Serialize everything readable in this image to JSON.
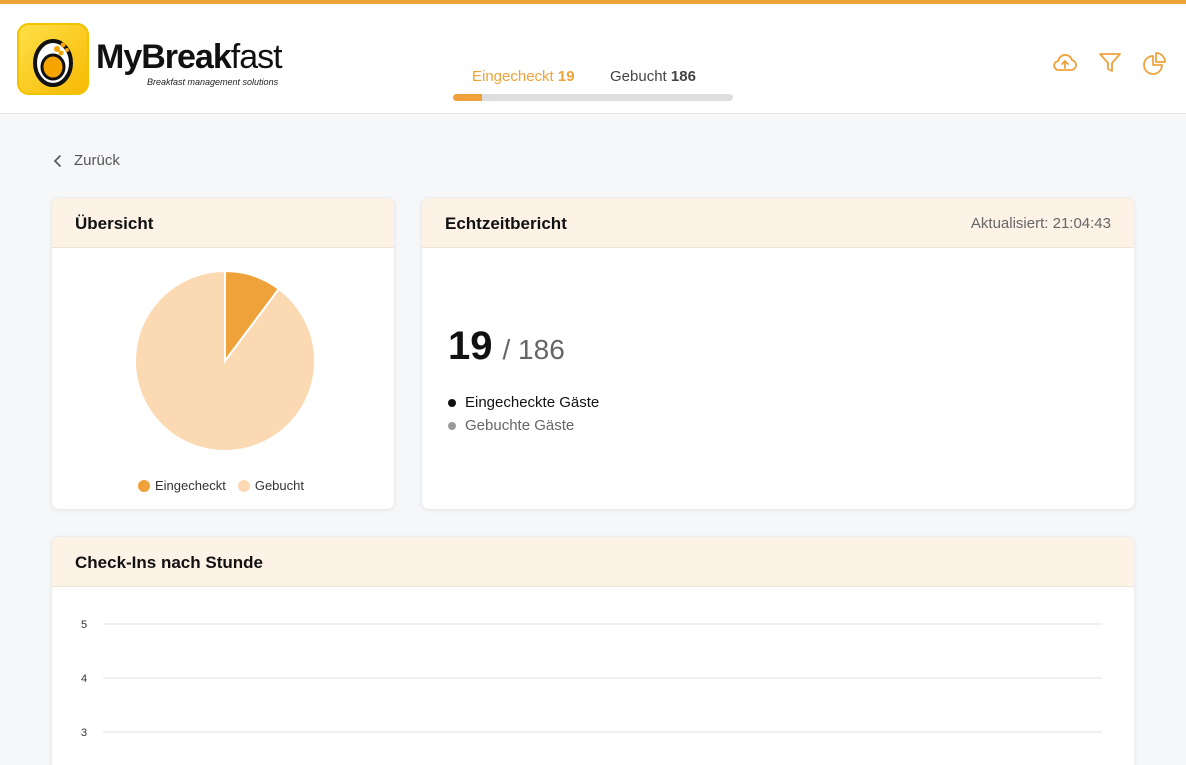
{
  "header": {
    "brand_bold": "MyBreak",
    "brand_rest": "fast",
    "brand_tagline": "Breakfast management solutions",
    "tabs": [
      {
        "label": "Eingecheckt",
        "count": "19"
      },
      {
        "label": "Gebucht",
        "count": "186"
      }
    ],
    "progress_fraction": 0.102,
    "icons": [
      "cloud-upload-icon",
      "filter-icon",
      "pie-chart-icon"
    ],
    "accent": "#f0a23a"
  },
  "nav": {
    "back_label": "Zurück"
  },
  "overview": {
    "title": "Übersicht",
    "legend": [
      {
        "label": "Eingecheckt",
        "color": "#f0a23a"
      },
      {
        "label": "Gebucht",
        "color": "#fbd9b3"
      }
    ]
  },
  "realtime": {
    "title": "Echtzeitbericht",
    "updated": "Aktualisiert: 21:04:43",
    "checked_in": "19",
    "booked": "/ 186",
    "legend": [
      {
        "label": "Eingecheckte Gäste",
        "color": "#111111"
      },
      {
        "label": "Gebuchte Gäste",
        "color": "#9a9a9a"
      }
    ]
  },
  "hourly": {
    "title": "Check-Ins nach Stunde"
  },
  "chart_data": [
    {
      "type": "pie",
      "labels": [
        "Eingecheckt",
        "Gebucht"
      ],
      "values": [
        19,
        167
      ],
      "colors": [
        "#f0a23a",
        "#fbd9b3"
      ]
    },
    {
      "type": "bar",
      "title": "Check-Ins nach Stunde",
      "y_ticks": [
        "5",
        "4",
        "3"
      ],
      "ylim": [
        3,
        5
      ],
      "categories": [],
      "values": []
    }
  ]
}
